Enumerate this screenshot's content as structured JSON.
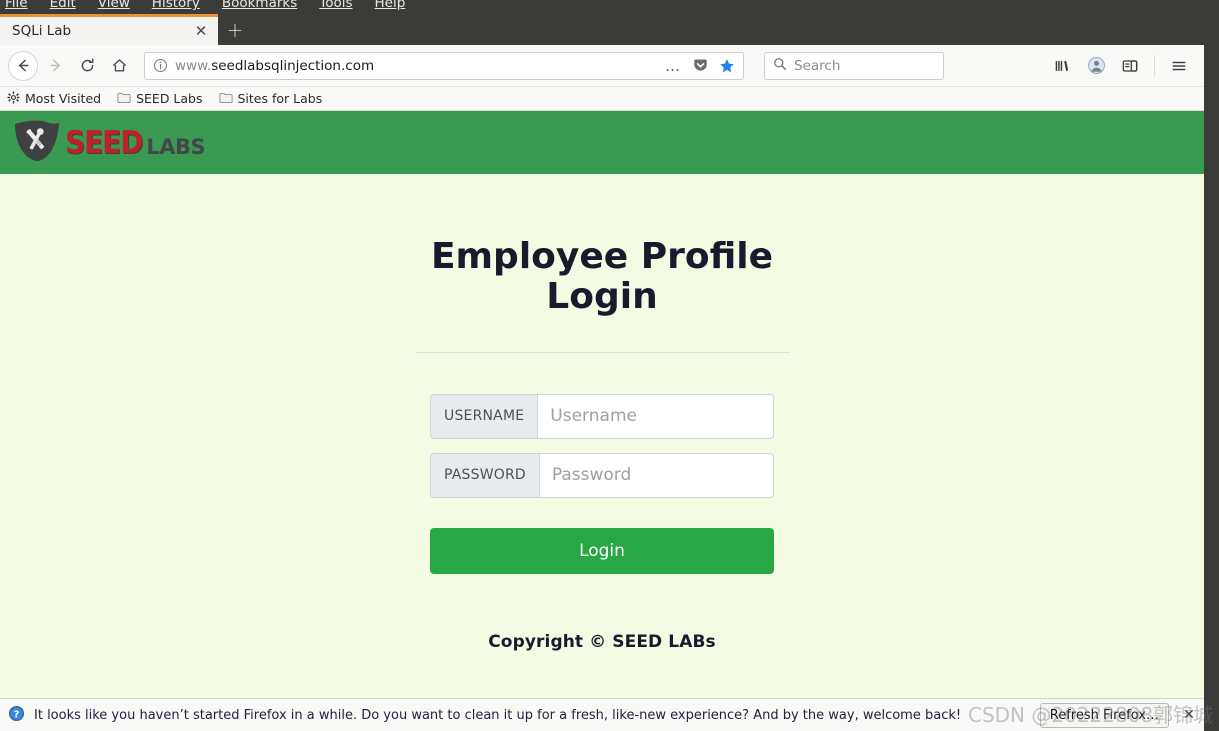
{
  "app": {
    "menu_items": [
      "File",
      "Edit",
      "View",
      "History",
      "Bookmarks",
      "Tools",
      "Help"
    ]
  },
  "tabs": {
    "active_title": "SQLi Lab",
    "close_label": "✕",
    "newtab_label": "+"
  },
  "navigation": {
    "back_label": "←",
    "forward_label": "→",
    "reload_label": "⟳",
    "home_label": "⌂",
    "url_prefix": "www.",
    "url_domain": "seedlabsqlinjection.com",
    "page_actions_label": "…",
    "pocket_label": "pocket",
    "bookmark_star_label": "★",
    "library_label": "library",
    "account_label": "account",
    "sidebar_label": "sidebar",
    "menu_label": "☰"
  },
  "search": {
    "placeholder": "Search",
    "value": ""
  },
  "bookmarks": [
    {
      "label": "Most Visited",
      "icon": "gear-icon"
    },
    {
      "label": "SEED Labs",
      "icon": "folder-icon"
    },
    {
      "label": "Sites for Labs",
      "icon": "folder-icon"
    }
  ],
  "site": {
    "logo_seed": "SEED",
    "logo_labs": "LABS",
    "header_color": "#3a9a52",
    "page_background": "#f3fce3"
  },
  "page": {
    "title": "Employee Profile Login",
    "form": {
      "username": {
        "addon": "USERNAME",
        "placeholder": "Username",
        "value": ""
      },
      "password": {
        "addon": "PASSWORD",
        "placeholder": "Password",
        "value": ""
      },
      "submit_label": "Login",
      "submit_color": "#28a745"
    },
    "copyright": "Copyright © SEED LABs"
  },
  "notification": {
    "message": "It looks like you haven’t started Firefox in a while. Do you want to clean it up for a fresh, like-new experience? And by the way, welcome back!",
    "action_label": "Refresh Firefox…",
    "close_label": "✕"
  },
  "watermark": {
    "text": "CSDN @20222808郭锦城"
  }
}
